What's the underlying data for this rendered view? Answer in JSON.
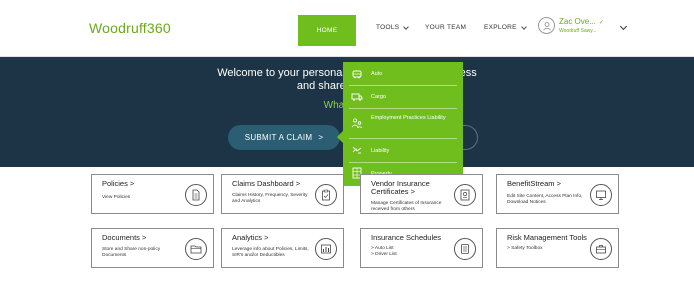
{
  "brand": {
    "logo": "Woodruff360",
    "accent": "#6fbe1e",
    "navy": "#1c3445"
  },
  "nav": {
    "home": "HOME",
    "tools": "TOOLS",
    "your_team": "YOUR TEAM",
    "explore": "EXPLORE"
  },
  "user": {
    "name": "Zac Ove...",
    "verified": "✓",
    "company": "Woodruff Sawy..."
  },
  "hero": {
    "welcome_line1": "Welcome to your personal                                  ccess",
    "welcome_line2": "and share your docu",
    "green_line": "What woul",
    "submit_label": "SUBMIT A CLAIM",
    "submit_arrow": ">"
  },
  "tools_menu": {
    "items": [
      {
        "label": "Auto",
        "icon": "car-icon"
      },
      {
        "label": "Cargo",
        "icon": "truck-icon"
      },
      {
        "label": "Employment Practices Liability",
        "icon": "people-icon"
      },
      {
        "label": "Liability",
        "icon": "hand-icon"
      },
      {
        "label": "Property",
        "icon": "building-icon"
      }
    ]
  },
  "cards": [
    {
      "title": "Policies  >",
      "desc": "View Policies",
      "icon": "document-icon"
    },
    {
      "title": "Claims Dashboard  >",
      "desc": "Claims History, Frequency, Severity and Analytics",
      "icon": "clipboard-icon"
    },
    {
      "title": "Vendor Insurance Certificates  >",
      "desc": "Manage Certificates of Insurance received from others",
      "icon": "certificate-icon"
    },
    {
      "title": "BenefitStream  >",
      "desc": "Edit Site Content, Access Plan Info, Download Notices",
      "icon": "monitor-icon"
    },
    {
      "title": "Documents  >",
      "desc": "Store and Share non-policy Documents",
      "icon": "folder-icon"
    },
    {
      "title": "Analytics  >",
      "desc": "Leverage info about Policies, Limits, SIR's and/or Deductibles",
      "icon": "chart-icon"
    },
    {
      "title": "Insurance Schedules",
      "desc": "> Auto List\n> Driver List",
      "desc1": "> Auto List",
      "desc2": "> Driver List",
      "icon": "list-icon"
    },
    {
      "title": "Risk Management Tools",
      "desc": "> Safety Toolbox",
      "icon": "toolbox-icon"
    }
  ]
}
